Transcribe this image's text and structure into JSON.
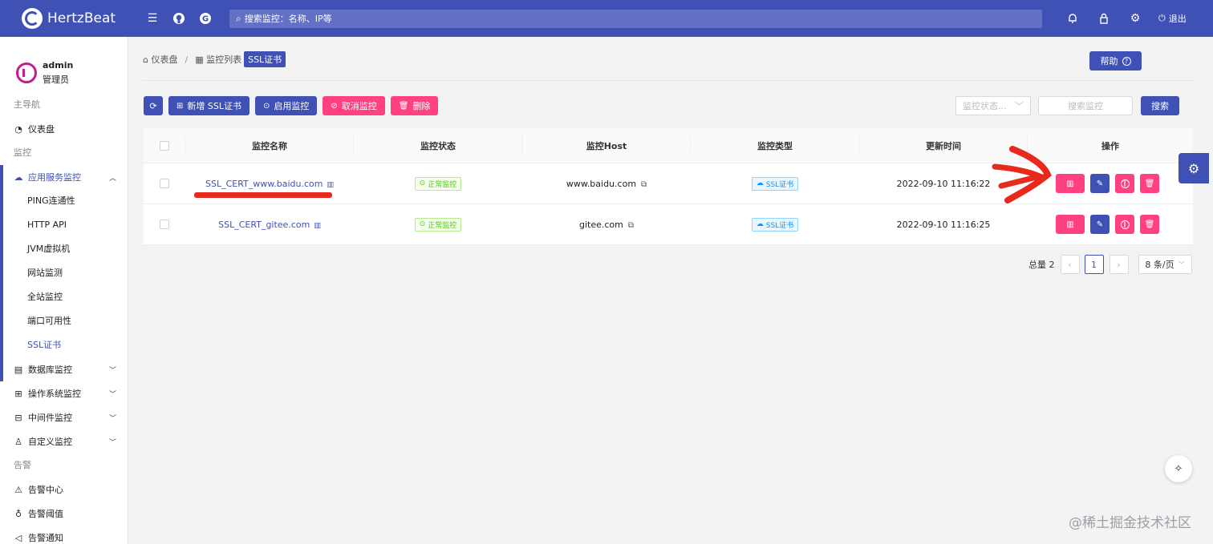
{
  "header": {
    "app_name": "HertzBeat",
    "search_placeholder": "搜索监控：名称、IP等",
    "logout_label": "退出"
  },
  "sidebar": {
    "user": {
      "name": "admin",
      "role": "管理员"
    },
    "group_main": "主导航",
    "dashboard": "仪表盘",
    "group_monitor": "监控",
    "app_service": "应用服务监控",
    "sub_items": [
      "PING连通性",
      "HTTP API",
      "JVM虚拟机",
      "网站监测",
      "全站监控",
      "端口可用性",
      "SSL证书"
    ],
    "database": "数据库监控",
    "os": "操作系统监控",
    "middleware": "中间件监控",
    "custom": "自定义监控",
    "group_alert": "告警",
    "alert_center": "告警中心",
    "alert_threshold": "告警阈值",
    "alert_notify": "告警通知"
  },
  "breadcrumb": {
    "home": "仪表盘",
    "list": "监控列表",
    "current": "SSL证书"
  },
  "help_label": "帮助",
  "toolbar": {
    "add_label": "新增 SSL证书",
    "enable_label": "启用监控",
    "cancel_label": "取消监控",
    "delete_label": "删除"
  },
  "filters": {
    "status_placeholder": "监控状态...",
    "search_placeholder": "搜索监控",
    "search_button": "搜索"
  },
  "table": {
    "headers": [
      "监控名称",
      "监控状态",
      "监控Host",
      "监控类型",
      "更新时间",
      "操作"
    ],
    "rows": [
      {
        "name": "SSL_CERT_www.baidu.com",
        "status": "正常监控",
        "host": "www.baidu.com",
        "type": "SSL证书",
        "updated": "2022-09-10 11:16:22"
      },
      {
        "name": "SSL_CERT_gitee.com",
        "status": "正常监控",
        "host": "gitee.com",
        "type": "SSL证书",
        "updated": "2022-09-10 11:16:25"
      }
    ]
  },
  "pagination": {
    "total_label": "总量 2",
    "current_page": "1",
    "page_size": "8 条/页"
  },
  "watermark": "@稀土掘金技术社区",
  "colors": {
    "primary": "#3f51b5",
    "accent": "#ff4081",
    "annotation": "#e8291d"
  }
}
